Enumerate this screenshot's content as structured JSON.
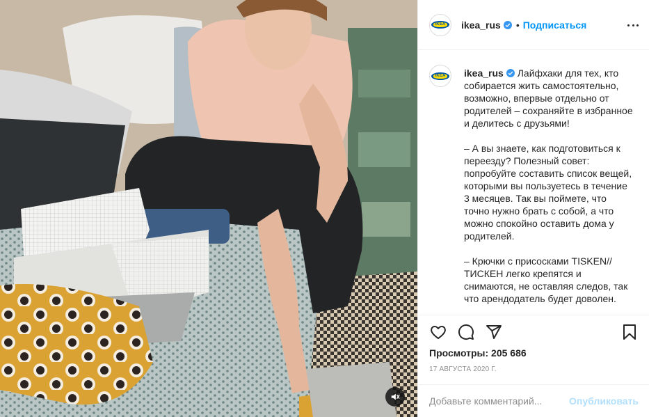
{
  "post": {
    "media_alt": "",
    "account": {
      "username": "ikea_rus",
      "avatar_logo_text": "IKEA",
      "verified": true,
      "separator": "•",
      "follow_label": "Подписаться"
    },
    "caption": {
      "username": "ikea_rus",
      "paragraphs": [
        "Лайфхаки для тех, кто собирается жить самостоятельно, возможно, впервые отдельно от родителей – сохраняйте в избранное и делитесь с друзьями!",
        "– А вы знаете, как подготовиться к переезду? Полезный совет: попробуйте составить список вещей, которыми вы пользуетесь в течение 3 месяцев. Так вы поймете, что точно нужно брать с собой, а что можно спокойно оставить дома у родителей.",
        "– Крючки с присосками TISKEN// ТИСКЕН легко крепятся и снимаются, не оставляя следов, так что арендодатель будет доволен."
      ]
    },
    "stats": {
      "views": "Просмотры: 205 686",
      "date": "17 августа 2020 г."
    },
    "comment": {
      "placeholder": "Добавьте комментарий...",
      "publish_label": "Опубликовать"
    },
    "colors": {
      "accent": "#0095f6",
      "publish_disabled": "#b2dffc",
      "muted": "#8e8e8e",
      "ikea_blue": "#0058a3",
      "ikea_yellow": "#ffdb00"
    },
    "icons": [
      "heart-icon",
      "comment-icon",
      "share-icon",
      "bookmark-icon",
      "more-icon",
      "mute-icon",
      "verified-icon"
    ]
  }
}
